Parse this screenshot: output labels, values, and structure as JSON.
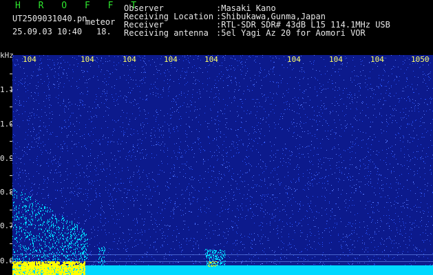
{
  "header": {
    "brand": "H R O F F T",
    "filename": "UT2509031040.pn",
    "mode": "meteor",
    "datetime": "25.09.03 10:40",
    "index": "18.",
    "info": [
      {
        "label": "Observer",
        "value": ":Masaki Kano"
      },
      {
        "label": "Receiving Location",
        "value": ":Shibukawa,Gunma,Japan"
      },
      {
        "label": "Receiver",
        "value": ":RTL-SDR SDR# 43dB L15 114.1MHz USB"
      },
      {
        "label": "Receiving antenna",
        "value": ":5el Yagi Az 20 for Aomori VOR"
      }
    ]
  },
  "axes": {
    "y_unit": "kHz",
    "y_labels": [
      "1.1",
      "1.0",
      "0.9",
      "0.8",
      "0.7",
      "0.6"
    ],
    "x_labels": [
      "104",
      "104",
      "104",
      "104",
      "104",
      "104",
      "104",
      "104",
      "1050"
    ]
  },
  "colors": {
    "background": "#0c1a8c",
    "noise": "#2a55ff",
    "trace": "#00d8ff",
    "echo": "#ffff00",
    "brand": "#2ee62e",
    "x_labels": "#ffff66"
  }
}
